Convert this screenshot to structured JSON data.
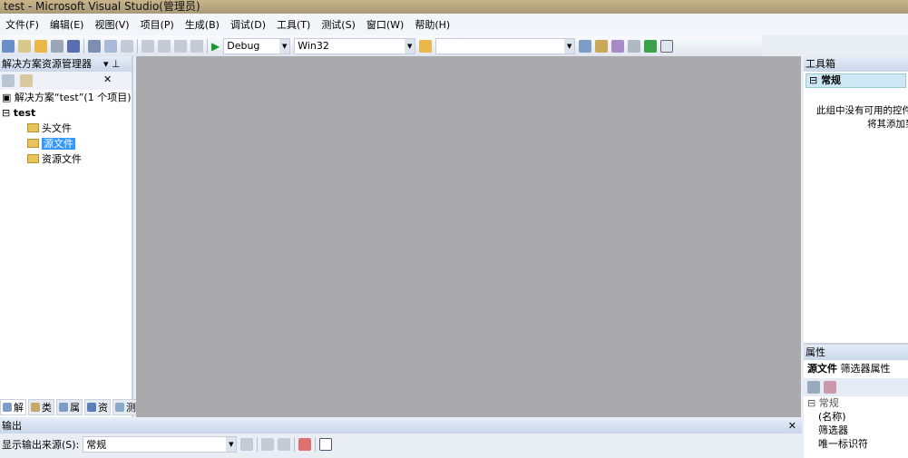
{
  "title": "test - Microsoft Visual Studio(管理员)",
  "menu": [
    "文件(F)",
    "编辑(E)",
    "视图(V)",
    "项目(P)",
    "生成(B)",
    "调试(D)",
    "工具(T)",
    "测试(S)",
    "窗口(W)",
    "帮助(H)"
  ],
  "toolbar": {
    "config": "Debug",
    "platform": "Win32",
    "find": ""
  },
  "solution_explorer": {
    "title": "解决方案资源管理器 ...",
    "solution": "解决方案“test”(1 个项目)",
    "project": "test",
    "folders": [
      "头文件",
      "源文件",
      "资源文件"
    ],
    "tabs": [
      "解",
      "类",
      "属",
      "资",
      "测"
    ]
  },
  "toolbox": {
    "title": "工具箱",
    "group": "常规",
    "empty_text": "此组中没有可用的控件",
    "empty_text2": "将其添加到"
  },
  "properties": {
    "title": "属性",
    "object": "源文件",
    "object_type": "筛选器属性",
    "category": "常规",
    "rows": [
      "(名称)",
      "筛选器",
      "唯一标识符"
    ]
  },
  "output": {
    "title": "输出",
    "source_label": "显示输出来源(S):",
    "source_value": "常规"
  }
}
